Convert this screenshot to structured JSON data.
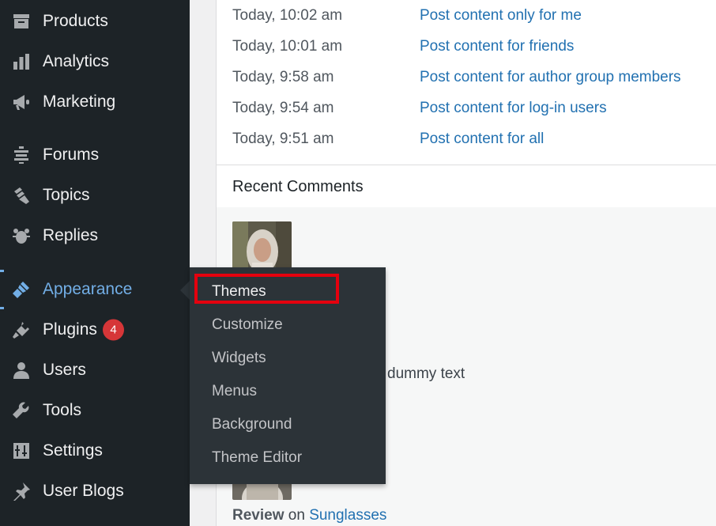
{
  "sidebar": {
    "items": [
      {
        "label": "Products",
        "icon": "archive-icon"
      },
      {
        "label": "Analytics",
        "icon": "bar-chart-icon"
      },
      {
        "label": "Marketing",
        "icon": "megaphone-icon"
      },
      {
        "label": "Forums",
        "icon": "forums-icon"
      },
      {
        "label": "Topics",
        "icon": "topics-icon"
      },
      {
        "label": "Replies",
        "icon": "replies-icon"
      },
      {
        "label": "Appearance",
        "icon": "paintbrush-icon",
        "active": true
      },
      {
        "label": "Plugins",
        "icon": "plugin-icon",
        "badge": "4"
      },
      {
        "label": "Users",
        "icon": "user-icon"
      },
      {
        "label": "Tools",
        "icon": "wrench-icon"
      },
      {
        "label": "Settings",
        "icon": "settings-icon"
      },
      {
        "label": "User Blogs",
        "icon": "pin-icon"
      }
    ],
    "accent_color": "#72aee6",
    "badge_color": "#d63638"
  },
  "appearance_submenu": {
    "items": [
      {
        "label": "Themes",
        "highlighted": true
      },
      {
        "label": "Customize"
      },
      {
        "label": "Widgets"
      },
      {
        "label": "Menus"
      },
      {
        "label": "Background"
      },
      {
        "label": "Theme Editor"
      }
    ],
    "highlight_color": "#e5000e"
  },
  "activity": {
    "rows": [
      {
        "time": "Today, 10:02 am",
        "title": "Post content only for me"
      },
      {
        "time": "Today, 10:01 am",
        "title": "Post content for friends"
      },
      {
        "time": "Today, 9:58 am",
        "title": "Post content for author group members"
      },
      {
        "time": "Today, 9:54 am",
        "title": "Post content for log-in users"
      },
      {
        "time": "Today, 9:51 am",
        "title": "Post content for all"
      }
    ]
  },
  "recent_comments": {
    "title": "Recent Comments",
    "comment_excerpt": "dummy text",
    "review": {
      "type": "Review",
      "on": "on",
      "product": "Sunglasses"
    }
  }
}
